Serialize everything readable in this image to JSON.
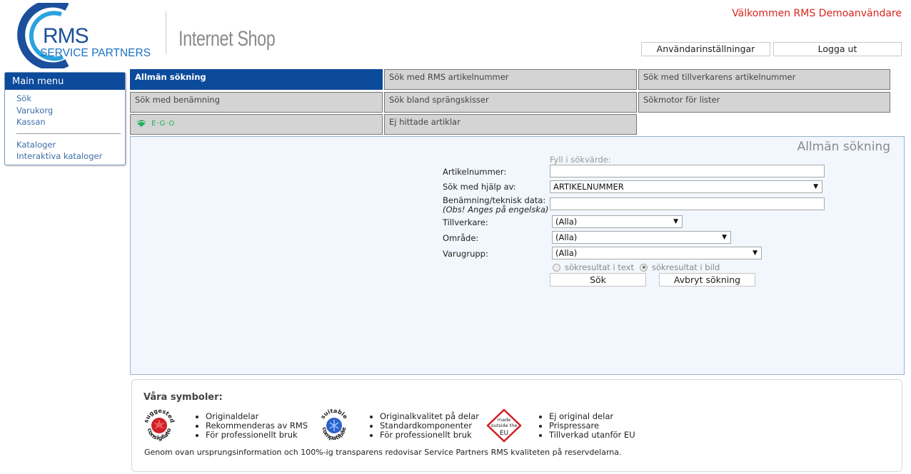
{
  "header": {
    "logo_text": "RMS",
    "logo_sub": "SERVICE PARTNERS",
    "shop_title": "Internet Shop",
    "welcome": "Välkommen RMS Demoanvändare",
    "user_settings_label": "Användarinställningar",
    "logout_label": "Logga ut"
  },
  "main_menu": {
    "title": "Main menu",
    "items": [
      "Sök",
      "Varukorg",
      "Kassan"
    ],
    "items2": [
      "Kataloger",
      "Interaktiva kataloger"
    ]
  },
  "tabs": [
    "Allmän sökning",
    "Sök med RMS artikelnummer",
    "Sök med tillverkarens artikelnummer",
    "Sök med benämning",
    "Sök bland sprängskisser",
    "Sökmotor för lister",
    "E·G·O",
    "Ej hittade artiklar"
  ],
  "search": {
    "title": "Allmän sökning",
    "fill_hint": "Fyll i sökvärde:",
    "label_article": "Artikelnummer:",
    "label_search_by": "Sök med hjälp av:",
    "search_by_value": "ARTIKELNUMMER",
    "label_name": "Benämning/teknisk data:",
    "label_name_note": "(Obs! Anges på engelska)",
    "label_manufacturer": "Tillverkare:",
    "manufacturer_value": "(Alla)",
    "label_area": "Område:",
    "area_value": "(Alla)",
    "label_group": "Varugrupp:",
    "group_value": "(Alla)",
    "radio_text": "sökresultat i text",
    "radio_image": "sökresultat i bild",
    "radio_selected": "image",
    "search_button": "Sök",
    "cancel_button": "Avbryt sökning"
  },
  "symbols": {
    "title": "Våra symboler:",
    "badge1": "suggested consigliato",
    "badge2": "suitable compatibile",
    "badge3": "made outside the EU",
    "list1": [
      "Originaldelar",
      "Rekommenderas av RMS",
      "För professionellt bruk"
    ],
    "list2": [
      "Originalkvalitet på delar",
      "Standardkomponenter",
      "För professionellt bruk"
    ],
    "list3": [
      "Ej original delar",
      "Prispressare",
      "Tillverkad utanför EU"
    ],
    "footer": "Genom ovan ursprungsinformation och 100%-ig transparens redovisar Service Partners RMS kvaliteten på reservdelarna."
  },
  "colors": {
    "brand_blue": "#0c4a9b",
    "welcome_red": "#d9261c",
    "ego_green": "#1fae5a"
  }
}
